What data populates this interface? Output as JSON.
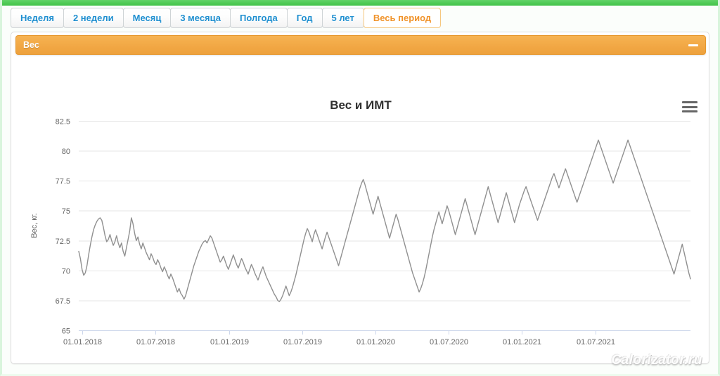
{
  "theme": {
    "accent_green": "#4dc954",
    "accent_orange": "#f2a845",
    "link_blue": "#1f8fd0",
    "active_tab_text": "#f0932b",
    "series_color": "#909090",
    "grid_color": "#e6e6e6",
    "axis_color": "#ccd6eb",
    "label_color": "#666666"
  },
  "period_tabs": {
    "items": [
      {
        "label": "Неделя",
        "active": false
      },
      {
        "label": "2 недели",
        "active": false
      },
      {
        "label": "Месяц",
        "active": false
      },
      {
        "label": "3 месяца",
        "active": false
      },
      {
        "label": "Полгода",
        "active": false
      },
      {
        "label": "Год",
        "active": false
      },
      {
        "label": "5 лет",
        "active": false
      },
      {
        "label": "Весь период",
        "active": true
      }
    ]
  },
  "panel": {
    "title": "Вес",
    "collapse_icon": "minus-icon"
  },
  "chart": {
    "title": "Вес и ИМТ",
    "menu_icon": "hamburger-menu-icon"
  },
  "watermark": {
    "text": "Calorizator.ru"
  },
  "chart_data": {
    "type": "line",
    "title": "Вес и ИМТ",
    "xlabel": "",
    "ylabel": "Вес, кг.",
    "ylim": [
      65,
      82.5
    ],
    "yticks": [
      65,
      67.5,
      70,
      72.5,
      75,
      77.5,
      80,
      82.5
    ],
    "ytick_labels": [
      "65",
      "67.5",
      "70",
      "72.5",
      "75",
      "77.5",
      "80",
      "82.5"
    ],
    "xticks": [
      "01.01.2018",
      "01.07.2018",
      "01.01.2019",
      "01.07.2019",
      "01.01.2020",
      "01.07.2020",
      "01.01.2021",
      "01.07.2021"
    ],
    "xlim": [
      "01.01.2018",
      "01.11.2021"
    ],
    "grid": true,
    "legend": false,
    "series": [
      {
        "name": "Вес, кг.",
        "color": "#909090",
        "values": [
          71.6,
          71.0,
          70.1,
          69.6,
          69.8,
          70.4,
          71.3,
          72.1,
          72.8,
          73.4,
          73.8,
          74.1,
          74.3,
          74.4,
          74.2,
          73.6,
          72.9,
          72.4,
          72.6,
          73.0,
          72.5,
          72.1,
          72.4,
          72.9,
          72.3,
          71.9,
          72.3,
          71.6,
          71.2,
          71.9,
          72.6,
          73.3,
          74.4,
          73.9,
          73.1,
          72.5,
          72.8,
          72.2,
          71.8,
          72.3,
          71.9,
          71.5,
          71.2,
          70.9,
          71.4,
          71.1,
          70.7,
          70.5,
          70.9,
          70.6,
          70.2,
          69.9,
          70.3,
          70.0,
          69.6,
          69.3,
          69.7,
          69.4,
          69.0,
          68.6,
          68.2,
          68.5,
          68.1,
          67.9,
          67.6,
          67.9,
          68.4,
          68.9,
          69.4,
          69.9,
          70.4,
          70.8,
          71.2,
          71.6,
          71.9,
          72.2,
          72.4,
          72.5,
          72.3,
          72.6,
          72.9,
          72.7,
          72.3,
          71.9,
          71.5,
          71.1,
          70.7,
          70.9,
          71.2,
          70.8,
          70.4,
          70.1,
          70.5,
          70.9,
          71.3,
          70.9,
          70.5,
          70.2,
          70.6,
          71.0,
          70.7,
          70.3,
          70.0,
          69.7,
          70.1,
          70.5,
          70.2,
          69.8,
          69.5,
          69.2,
          69.6,
          70.0,
          70.3,
          69.9,
          69.5,
          69.2,
          68.9,
          68.6,
          68.3,
          68.0,
          67.8,
          67.5,
          67.4,
          67.6,
          67.9,
          68.3,
          68.7,
          68.3,
          67.9,
          68.2,
          68.6,
          69.1,
          69.6,
          70.2,
          70.8,
          71.4,
          72.0,
          72.6,
          73.1,
          73.5,
          73.2,
          72.8,
          72.4,
          73.0,
          73.4,
          73.0,
          72.6,
          72.2,
          71.8,
          72.3,
          72.8,
          73.2,
          72.8,
          72.4,
          72.0,
          71.6,
          71.2,
          70.8,
          70.4,
          70.9,
          71.4,
          71.9,
          72.4,
          72.9,
          73.4,
          73.9,
          74.4,
          74.9,
          75.4,
          75.9,
          76.4,
          76.9,
          77.3,
          77.6,
          77.2,
          76.7,
          76.2,
          75.7,
          75.2,
          74.7,
          75.2,
          75.7,
          76.2,
          75.7,
          75.2,
          74.7,
          74.2,
          73.7,
          73.2,
          72.7,
          73.2,
          73.7,
          74.2,
          74.7,
          74.3,
          73.8,
          73.3,
          72.8,
          72.3,
          71.8,
          71.3,
          70.8,
          70.3,
          69.8,
          69.4,
          69.0,
          68.6,
          68.2,
          68.5,
          68.9,
          69.4,
          70.0,
          70.7,
          71.4,
          72.1,
          72.8,
          73.4,
          73.9,
          74.4,
          74.9,
          74.4,
          73.9,
          74.4,
          74.9,
          75.4,
          75.0,
          74.5,
          74.0,
          73.5,
          73.0,
          73.5,
          74.0,
          74.5,
          75.0,
          75.5,
          76.0,
          75.5,
          75.0,
          74.5,
          74.0,
          73.5,
          73.0,
          73.5,
          74.0,
          74.5,
          75.0,
          75.5,
          76.0,
          76.5,
          77.0,
          76.5,
          76.0,
          75.5,
          75.0,
          74.5,
          74.0,
          74.5,
          75.0,
          75.5,
          76.0,
          76.5,
          76.0,
          75.5,
          75.0,
          74.5,
          74.0,
          74.5,
          75.0,
          75.5,
          75.9,
          76.3,
          76.7,
          77.0,
          76.6,
          76.2,
          75.8,
          75.4,
          75.0,
          74.6,
          74.2,
          74.6,
          75.0,
          75.4,
          75.8,
          76.2,
          76.6,
          77.0,
          77.4,
          77.8,
          78.1,
          77.7,
          77.3,
          76.9,
          77.3,
          77.7,
          78.1,
          78.5,
          78.1,
          77.7,
          77.3,
          76.9,
          76.5,
          76.1,
          75.7,
          76.1,
          76.5,
          76.9,
          77.3,
          77.7,
          78.1,
          78.5,
          78.9,
          79.3,
          79.7,
          80.1,
          80.5,
          80.9,
          80.5,
          80.1,
          79.7,
          79.3,
          78.9,
          78.5,
          78.1,
          77.7,
          77.3,
          77.7,
          78.1,
          78.5,
          78.9,
          79.3,
          79.7,
          80.1,
          80.5,
          80.9,
          80.5,
          80.1,
          79.7,
          79.3,
          78.9,
          78.5,
          78.1,
          77.7,
          77.3,
          76.9,
          76.5,
          76.1,
          75.7,
          75.3,
          74.9,
          74.5,
          74.1,
          73.7,
          73.3,
          72.9,
          72.5,
          72.1,
          71.7,
          71.3,
          70.9,
          70.5,
          70.1,
          69.7,
          70.2,
          70.7,
          71.2,
          71.7,
          72.2,
          71.6,
          71.0,
          70.4,
          69.8,
          69.3
        ]
      }
    ]
  }
}
